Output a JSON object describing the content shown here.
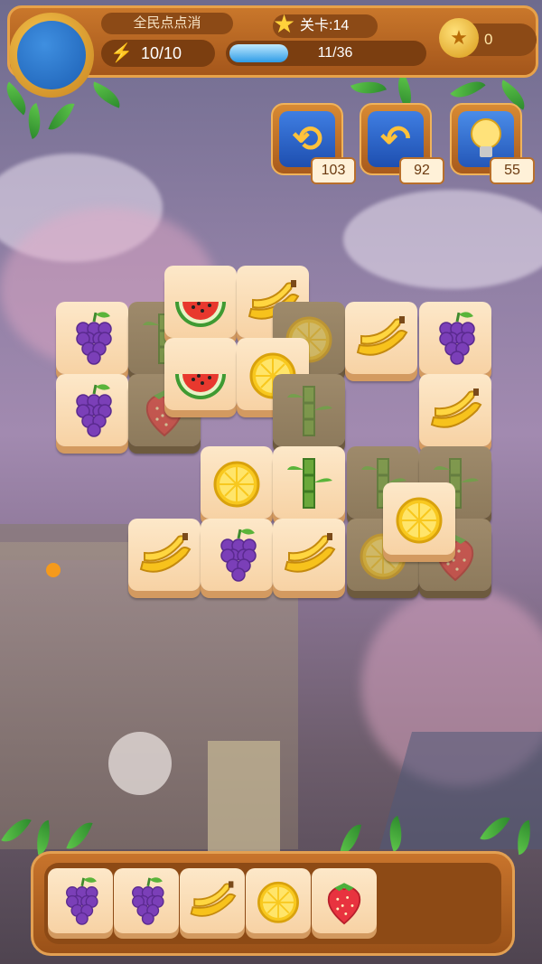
{
  "hud": {
    "game_title": "全民点点消",
    "energy": "10/10",
    "level": "关卡:14",
    "progress_text": "11/36",
    "progress_fraction": 0.305,
    "coins": "0"
  },
  "powerups": [
    {
      "name": "shuffle",
      "icon": "shuffle-arrows-icon",
      "count": "103"
    },
    {
      "name": "undo",
      "icon": "undo-arrow-icon",
      "count": "92"
    },
    {
      "name": "hint",
      "icon": "lightbulb-icon",
      "count": "55"
    }
  ],
  "board_tiles": [
    {
      "fruit": "grapes",
      "dim": false
    },
    {
      "fruit": "bamboo",
      "dim": true
    },
    {
      "fruit": "watermelon",
      "dim": false
    },
    {
      "fruit": "banana",
      "dim": false
    },
    {
      "fruit": "lemon",
      "dim": true
    },
    {
      "fruit": "banana",
      "dim": false
    },
    {
      "fruit": "grapes",
      "dim": false
    },
    {
      "fruit": "grapes",
      "dim": false
    },
    {
      "fruit": "strawberry",
      "dim": true
    },
    {
      "fruit": "watermelon",
      "dim": false
    },
    {
      "fruit": "lemon",
      "dim": false
    },
    {
      "fruit": "bamboo",
      "dim": true
    },
    {
      "fruit": "banana",
      "dim": false
    },
    {
      "fruit": "lemon",
      "dim": false
    },
    {
      "fruit": "bamboo",
      "dim": false
    },
    {
      "fruit": "bamboo",
      "dim": true
    },
    {
      "fruit": "bamboo",
      "dim": true
    },
    {
      "fruit": "banana",
      "dim": false
    },
    {
      "fruit": "grapes",
      "dim": false
    },
    {
      "fruit": "banana",
      "dim": false
    },
    {
      "fruit": "lemon",
      "dim": true
    },
    {
      "fruit": "strawberry",
      "dim": true
    },
    {
      "fruit": "lemon",
      "dim": false
    }
  ],
  "tray": [
    "grapes",
    "grapes",
    "banana",
    "lemon",
    "strawberry"
  ],
  "colors": {
    "wood": "#a4561b",
    "tile_face": "#fde8c9",
    "accent_blue": "#2d9be6"
  }
}
